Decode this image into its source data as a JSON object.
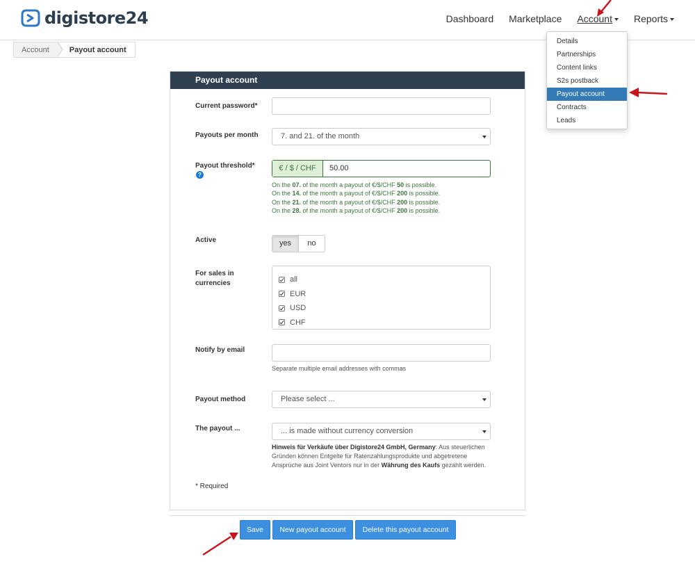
{
  "header": {
    "logo_text": "digistore24",
    "nav": {
      "dashboard": "Dashboard",
      "marketplace": "Marketplace",
      "account": "Account",
      "reports": "Reports"
    }
  },
  "breadcrumb": {
    "items": [
      "Account",
      "Payout account"
    ]
  },
  "account_menu": {
    "items": [
      "Details",
      "Partnerships",
      "Content links",
      "S2s postback",
      "Payout account",
      "Contracts",
      "Leads"
    ],
    "selected": "Payout account"
  },
  "form": {
    "title": "Payout account",
    "current_password": {
      "label": "Current password*",
      "value": ""
    },
    "payouts_per_month": {
      "label": "Payouts per month",
      "value": "7. and 21. of the month"
    },
    "payout_threshold": {
      "label": "Payout threshold*",
      "addon": "€ / $ / CHF",
      "value": "50.00",
      "help_icon": "?",
      "notes": [
        {
          "pre": "On the ",
          "day": "07.",
          "mid": " of the month a payout of €/$/CHF ",
          "amount": "50",
          "post": " is possible."
        },
        {
          "pre": "On the ",
          "day": "14.",
          "mid": " of the month a payout of €/$/CHF ",
          "amount": "200",
          "post": " is possible."
        },
        {
          "pre": "On the ",
          "day": "21.",
          "mid": " of the month a payout of €/$/CHF ",
          "amount": "200",
          "post": " is possible."
        },
        {
          "pre": "On the ",
          "day": "28.",
          "mid": " of the month a payout of €/$/CHF ",
          "amount": "200",
          "post": " is possible."
        }
      ]
    },
    "active": {
      "label": "Active",
      "yes": "yes",
      "no": "no",
      "selected": "yes"
    },
    "currencies": {
      "label": "For sales in currencies",
      "options": [
        "all",
        "EUR",
        "USD",
        "CHF"
      ],
      "checked": [
        true,
        true,
        true,
        true
      ]
    },
    "notify_email": {
      "label": "Notify by email",
      "value": "",
      "hint": "Separate multiple email addresses with commas"
    },
    "payout_method": {
      "label": "Payout method",
      "value": "Please select ..."
    },
    "the_payout": {
      "label": "The payout ...",
      "value": "... is made without currency conversion",
      "notice_bold": "Hinweis für Verkäufe über Digistore24 GmbH, Germany",
      "notice_text": ": Aus steuerlichen Gründen können Entgelte für Ratenzahlungsprodukte und abgetretene Ansprüche aus Joint Ventors nur in der ",
      "notice_bold2": "Währung des Kaufs",
      "notice_end": " gezahlt werden."
    },
    "required_note": "* Required"
  },
  "actions": {
    "save": "Save",
    "new": "New payout account",
    "delete": "Delete this payout account"
  },
  "colors": {
    "header_bar": "#2f4050",
    "primary_button": "#3d8fe0",
    "selected_menu": "#337ab7",
    "success_green": "#3c763d",
    "annotation_arrow": "#c8161d"
  }
}
